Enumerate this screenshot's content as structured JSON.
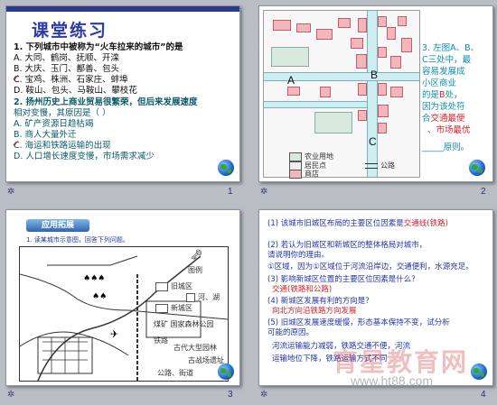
{
  "slides": [
    {
      "number": "1",
      "title": "课堂练习",
      "lines": [
        {
          "text": "1. 下列城市中被称为“火车拉来的城市”的是",
          "color": "black"
        },
        {
          "text": "A. 大同、鹤岗、抚顺、开滦",
          "color": "black"
        },
        {
          "text": "B. 大庆、玉门、鄯善、包头",
          "color": "black"
        },
        {
          "text": "C. 宝鸡、株洲、石家庄、蚌埠",
          "color": "black"
        },
        {
          "text": "D. 鞍山、包头、马鞍山、攀枝花",
          "color": "black"
        },
        {
          "text": "2. 扬州历史上商业贸易很繁荣，但后来发展速度",
          "color": "teal"
        },
        {
          "text": "相对变慢，其原因是（     ）",
          "color": "teal"
        },
        {
          "text": "A. 矿产资源日趋枯竭",
          "color": "teal"
        },
        {
          "text": "B. 商人大量外迁",
          "color": "teal"
        },
        {
          "text": "C. 海运和铁路运输的出现",
          "color": "teal"
        },
        {
          "text": "D. 人口增长速度变慢，市场需求减少",
          "color": "teal"
        }
      ],
      "check_mark": "✓"
    },
    {
      "number": "2",
      "map_letters": [
        "A",
        "B",
        "B",
        "C"
      ],
      "side_text": [
        {
          "text": "3. 左图A、B、",
          "style": "normal"
        },
        {
          "text": "C三处中，最",
          "style": "normal"
        },
        {
          "text": "容易发展成",
          "style": "normal"
        },
        {
          "text": "小区商业",
          "style": "normal"
        },
        {
          "text": "的是",
          "style": "normal",
          "extra": "B",
          "extra_after": "处，"
        },
        {
          "text": "因为该处符",
          "style": "normal"
        },
        {
          "text": "合",
          "style": "normal",
          "extra": "交通最便",
          "extra_after": ""
        },
        {
          "text": "",
          "style": "normal",
          "extra": "、市场最优",
          "extra_after": ""
        },
        {
          "text": "_____原则。",
          "style": "normal"
        }
      ],
      "legend": [
        "农业用地",
        "居民点",
        "商店"
      ],
      "legend_road": "公路"
    },
    {
      "number": "3",
      "badge": "应用拓展",
      "task": "1. 读某城市示意图，回答下列问题。",
      "map_labels": {
        "legend_title": "图例",
        "old_city": "旧城区",
        "new_city": "新城区",
        "river_lake": "河、湖",
        "coal_mine": "煤矿",
        "forest_park": "国家森林公园",
        "railway": "铁路",
        "ancient_garden": "古代大型园林",
        "ancient_ruins": "古战场遗址",
        "highway_street": "公路、街道"
      }
    },
    {
      "number": "4",
      "lines": [
        {
          "text": "(1) 该城市旧城区布局的主要区位因素是",
          "color": "blue",
          "extra": "交通线(铁路)",
          "extra_color": "red"
        },
        {
          "text": "(2) 若认为旧城区和新城区的整体格局对城市，",
          "color": "blue"
        },
        {
          "text": "请说明你的理由。",
          "color": "blue"
        },
        {
          "text": "①区域，因为①区域位于河流沿岸边，交通便利，水源充足。",
          "color": "blue"
        },
        {
          "text": "(3) 影响新城区位置的主要区位因素是什么？",
          "color": "blue"
        },
        {
          "text": "交通(铁路和公路)",
          "color": "red",
          "indent": true
        },
        {
          "text": "(4) 新城区发展有利的方向是？",
          "color": "blue"
        },
        {
          "text": "向北方向沿铁路方向发展",
          "color": "red",
          "indent": true
        },
        {
          "text": "(5) 旧城区发展速度缓慢，形态基本保持不变，试分析",
          "color": "blue"
        },
        {
          "text": "可能的原因。",
          "color": "blue"
        },
        {
          "text": "河流运输能力减弱，铁路交通不便，河流",
          "color": "blue",
          "indent": true
        },
        {
          "text": "运输地位下降，铁路运输方式不同",
          "color": "blue",
          "indent": true
        }
      ]
    }
  ],
  "watermark": {
    "text": "育星教育网",
    "url": "www.ht88.com"
  },
  "colors": {
    "title_blue": "#2d3ba6",
    "teal": "#0c5a68",
    "red": "#d3242b",
    "cyan": "#0c8fb0",
    "pink_block": "#f1b7bd",
    "road": "#cfeef2"
  }
}
